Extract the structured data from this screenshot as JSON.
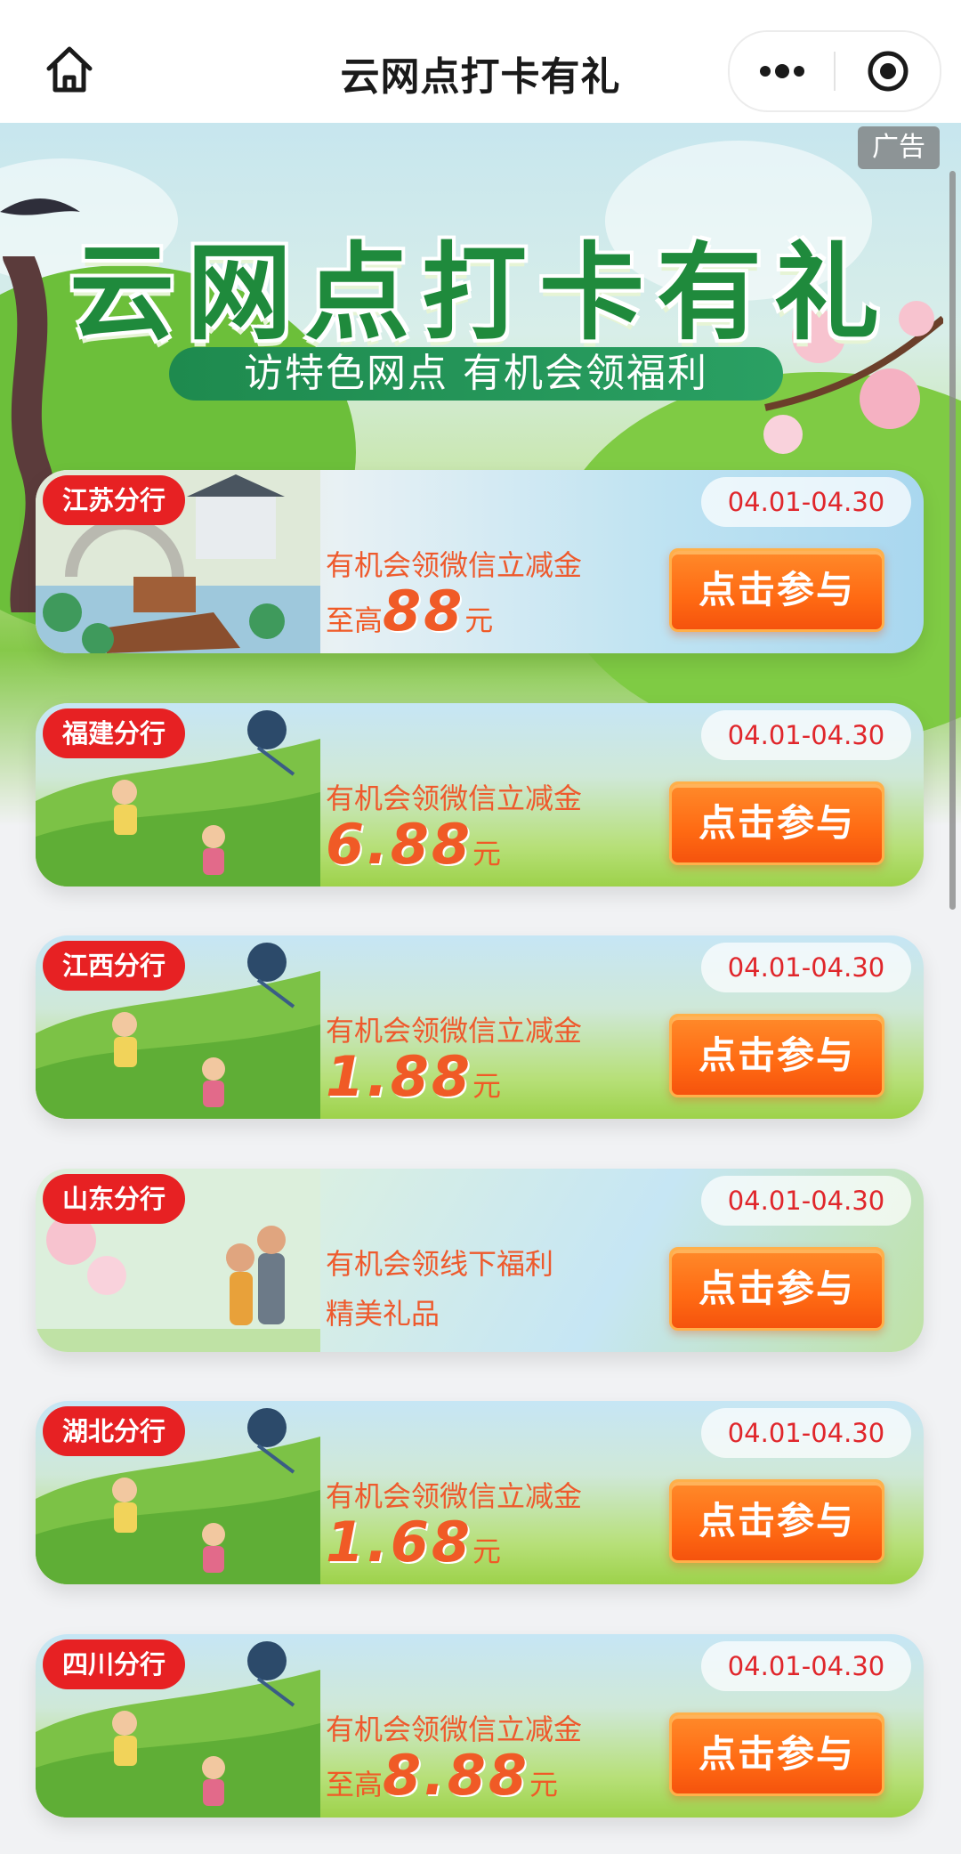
{
  "nav": {
    "title": "云网点打卡有礼"
  },
  "hero": {
    "title": "云网点打卡有礼",
    "subtitle": "访特色网点  有机会领福利",
    "ad_label": "广告"
  },
  "button_label": "点击参与",
  "cards": [
    {
      "branch": "江苏分行",
      "date": "04.01-04.30",
      "line1": "有机会领微信立减金",
      "prefix": "至高",
      "amount": "88",
      "unit": "元",
      "line2": ""
    },
    {
      "branch": "福建分行",
      "date": "04.01-04.30",
      "line1": "有机会领微信立减金",
      "prefix": "",
      "amount": "6.88",
      "unit": "元",
      "line2": ""
    },
    {
      "branch": "江西分行",
      "date": "04.01-04.30",
      "line1": "有机会领微信立减金",
      "prefix": "",
      "amount": "1.88",
      "unit": "元",
      "line2": ""
    },
    {
      "branch": "山东分行",
      "date": "04.01-04.30",
      "line1": "有机会领线下福利",
      "prefix": "",
      "amount": "",
      "unit": "",
      "line2": "精美礼品"
    },
    {
      "branch": "湖北分行",
      "date": "04.01-04.30",
      "line1": "有机会领微信立减金",
      "prefix": "",
      "amount": "1.68",
      "unit": "元",
      "line2": ""
    },
    {
      "branch": "四川分行",
      "date": "04.01-04.30",
      "line1": "有机会领微信立减金",
      "prefix": "至高",
      "amount": "8.88",
      "unit": "元",
      "line2": ""
    }
  ],
  "icons": {
    "home": "home-icon",
    "more": "more-dots-icon",
    "close": "target-circle-icon"
  }
}
